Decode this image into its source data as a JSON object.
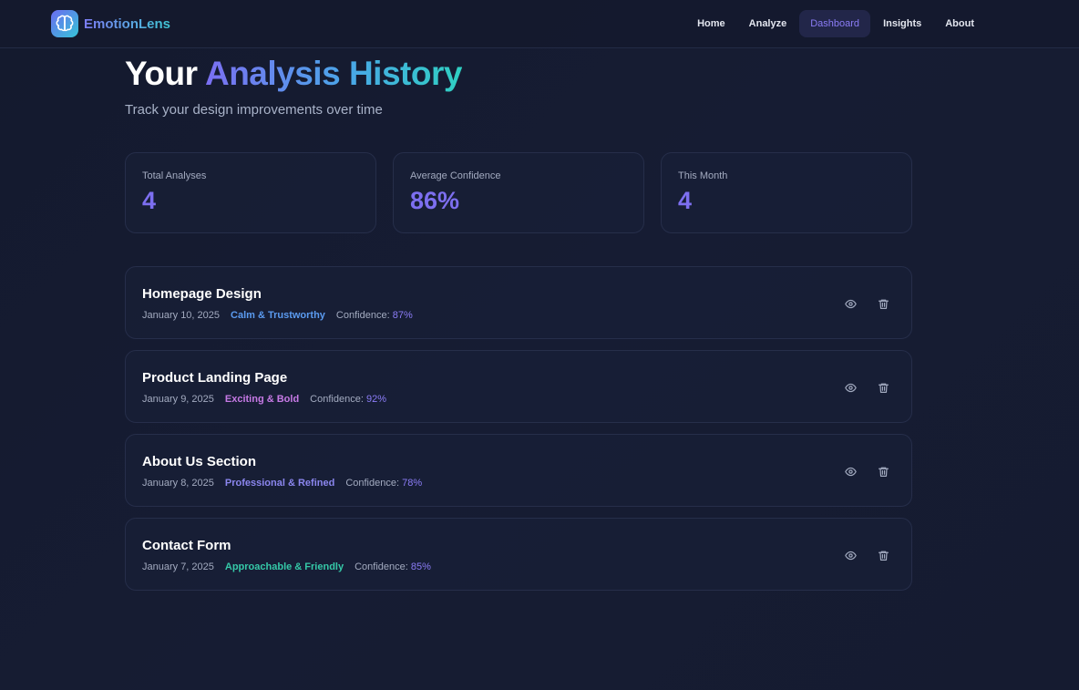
{
  "brand": {
    "name": "EmotionLens",
    "logo_icon": "brain-icon"
  },
  "nav": {
    "items": [
      {
        "label": "Home",
        "active": false
      },
      {
        "label": "Analyze",
        "active": false
      },
      {
        "label": "Dashboard",
        "active": true
      },
      {
        "label": "Insights",
        "active": false
      },
      {
        "label": "About",
        "active": false
      }
    ]
  },
  "header": {
    "title_plain": "Your",
    "title_gradient": "Analysis History",
    "subtitle": "Track your design improvements over time"
  },
  "stats": [
    {
      "label": "Total Analyses",
      "value": "4"
    },
    {
      "label": "Average Confidence",
      "value": "86%"
    },
    {
      "label": "This Month",
      "value": "4"
    }
  ],
  "history": [
    {
      "title": "Homepage Design",
      "date": "January 10, 2025",
      "tag": "Calm & Trustworthy",
      "tag_color": "#5b9bf0",
      "confidence_label": "Confidence:",
      "confidence_value": "87%"
    },
    {
      "title": "Product Landing Page",
      "date": "January 9, 2025",
      "tag": "Exciting & Bold",
      "tag_color": "#c77ae6",
      "confidence_label": "Confidence:",
      "confidence_value": "92%"
    },
    {
      "title": "About Us Section",
      "date": "January 8, 2025",
      "tag": "Professional & Refined",
      "tag_color": "#8b86ee",
      "confidence_label": "Confidence:",
      "confidence_value": "78%"
    },
    {
      "title": "Contact Form",
      "date": "January 7, 2025",
      "tag": "Approachable & Friendly",
      "tag_color": "#35c9a8",
      "confidence_label": "Confidence:",
      "confidence_value": "85%"
    }
  ],
  "icons": {
    "view": "eye-icon",
    "delete": "trash-icon"
  },
  "colors": {
    "accent": "#7d6ff0",
    "active_nav_bg": "#222649",
    "background": "#141a2e"
  }
}
